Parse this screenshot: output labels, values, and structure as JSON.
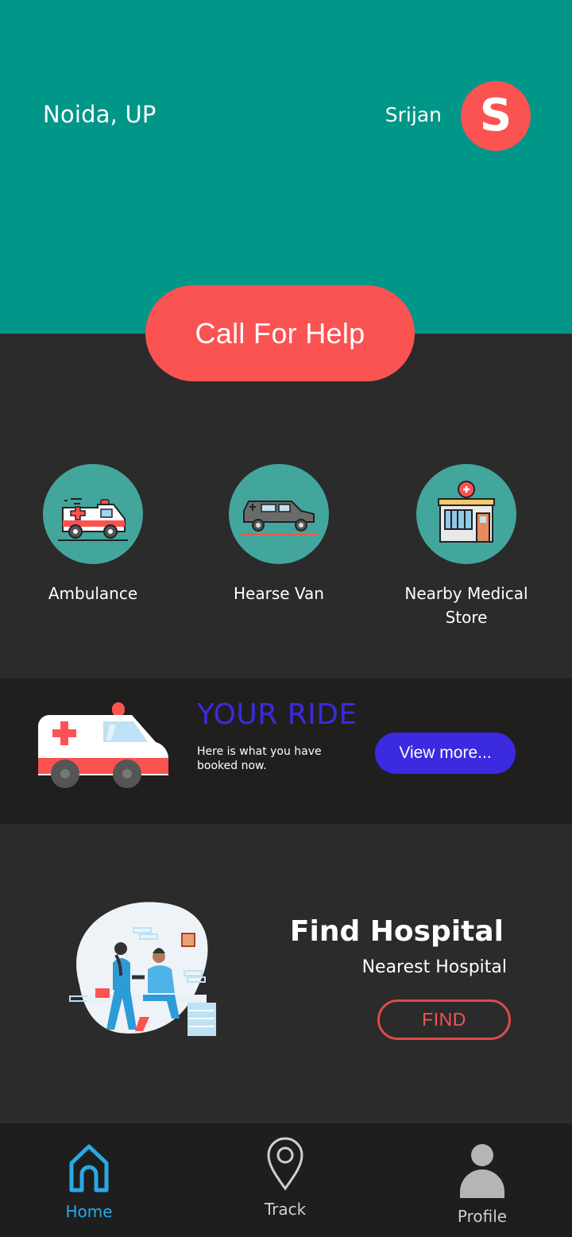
{
  "header": {
    "location": "Noida, UP",
    "username": "Srijan",
    "avatar_letter": "S",
    "background_color": "#009688"
  },
  "call_button": {
    "label": "Call For Help",
    "color": "#fb5252"
  },
  "services": [
    {
      "label": "Ambulance",
      "icon": "ambulance-icon"
    },
    {
      "label": "Hearse Van",
      "icon": "hearse-van-icon"
    },
    {
      "label": "Nearby Medical Store",
      "icon": "medical-store-icon"
    }
  ],
  "ride": {
    "title": "YOUR RIDE",
    "subtitle": "Here is what you have booked now.",
    "button_label": "View more...",
    "accent": "#3c2ae0"
  },
  "hospital": {
    "title": "Find Hospital",
    "subtitle": "Nearest Hospital",
    "button_label": "FIND"
  },
  "tabs": [
    {
      "label": "Home",
      "icon": "home-icon",
      "active": true
    },
    {
      "label": "Track",
      "icon": "location-pin-icon",
      "active": false
    },
    {
      "label": "Profile",
      "icon": "person-icon",
      "active": false
    }
  ]
}
